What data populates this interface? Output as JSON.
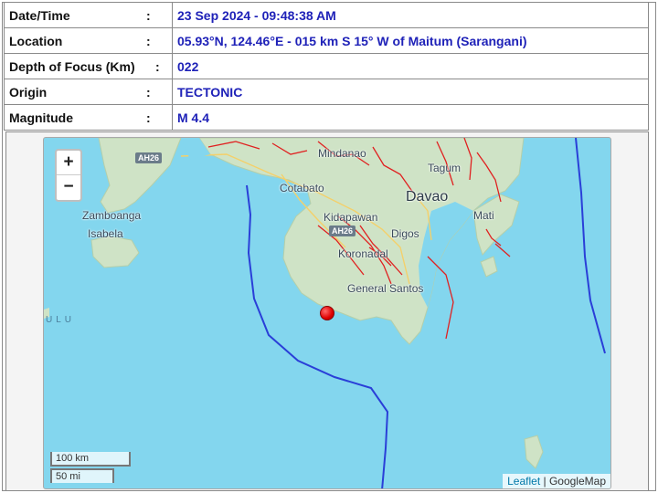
{
  "info": {
    "rows": [
      {
        "label": "Date/Time",
        "colon": ":",
        "value": "23 Sep 2024 - 09:48:38 AM"
      },
      {
        "label": "Location",
        "colon": ":",
        "value": "05.93°N, 124.46°E - 015 km S 15° W of Maitum (Sarangani)"
      },
      {
        "label": "Depth of Focus (Km)",
        "colon": ":",
        "value": "022"
      },
      {
        "label": "Origin",
        "colon": ":",
        "value": "TECTONIC"
      },
      {
        "label": "Magnitude",
        "colon": ":",
        "value": "M 4.4"
      }
    ]
  },
  "map": {
    "zoom_in": "+",
    "zoom_out": "−",
    "scale_km": "100 km",
    "scale_mi": "50 mi",
    "attribution_leaflet": "Leaflet",
    "attribution_sep": " | ",
    "attribution_google": "GoogleMap",
    "places": {
      "mindanao": "Mindanao",
      "tagum": "Tagum",
      "cotabato": "Cotabato",
      "davao": "Davao",
      "zamboanga": "Zamboanga",
      "kidapawan": "Kidapawan",
      "mati": "Mati",
      "isabela": "Isabela",
      "digos": "Digos",
      "koronadal": "Koronadal",
      "general_santos": "General Santos",
      "sea": "ULU"
    },
    "roads": {
      "ah26_a": "AH26",
      "ah26_b": "AH26"
    },
    "epicenter_color": "#e00000",
    "water_color": "#83d6ee",
    "land_color": "#cfe3c6",
    "fault_color": "#e02020",
    "trench_color": "#2a3fd8"
  }
}
